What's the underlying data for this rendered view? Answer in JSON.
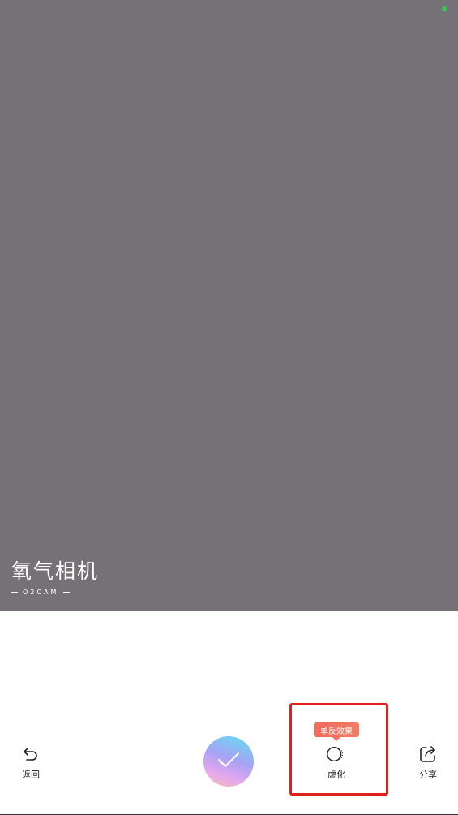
{
  "watermark": {
    "title": "氧气相机",
    "subtitle": "O2CAM"
  },
  "toolbar": {
    "back_label": "返回",
    "blur_label": "虚化",
    "share_label": "分享",
    "tooltip": "单反效果"
  },
  "colors": {
    "preview_bg": "#767176",
    "status_dot": "#34c759",
    "highlight": "#e0201a"
  },
  "icons": {
    "back": "undo-arrow-icon",
    "confirm": "checkmark-icon",
    "blur": "blur-circle-icon",
    "share": "share-arrow-icon"
  }
}
